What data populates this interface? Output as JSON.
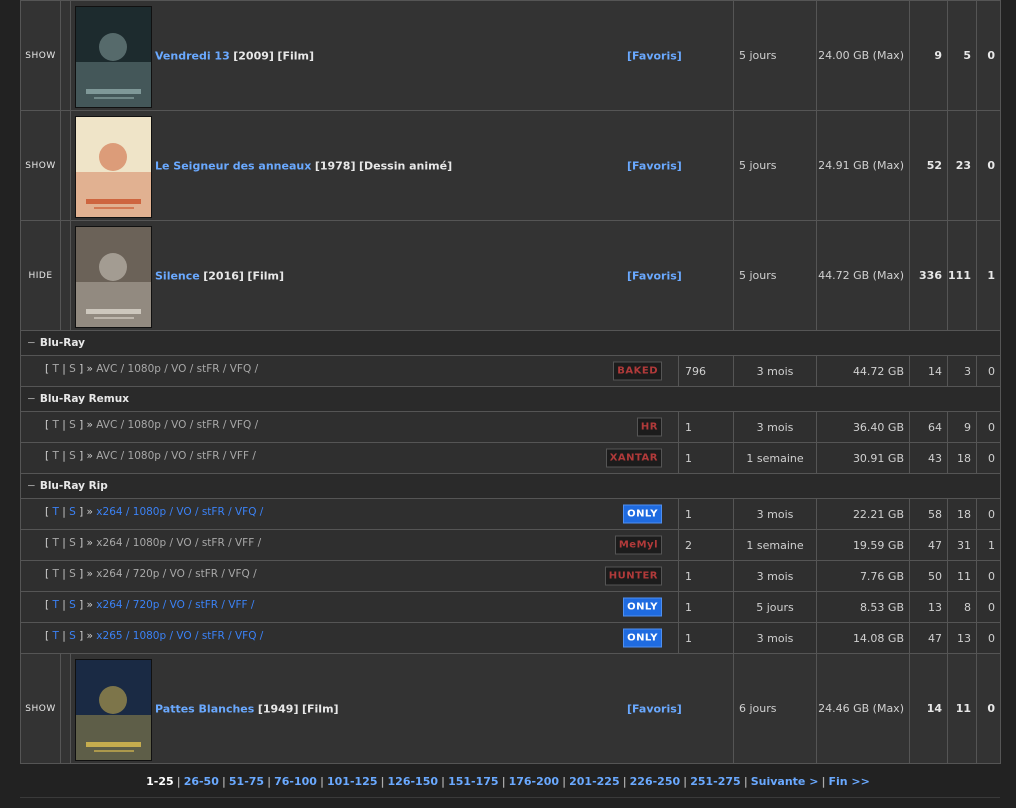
{
  "rows": [
    {
      "kind": "movie",
      "toggle": "SHOW",
      "title": "Vendredi 13",
      "year": "[2009]",
      "type": "[Film]",
      "fav": "[Favoris]",
      "age": "5 jours",
      "size": "24.00 GB (Max)",
      "n1": "9",
      "n2": "5",
      "n3": "0",
      "poster": {
        "bg": "#1d2b2e",
        "accent": "#8fa9a8"
      }
    },
    {
      "kind": "movie",
      "toggle": "SHOW",
      "title": "Le Seigneur des anneaux",
      "year": "[1978]",
      "type": "[Dessin animé]",
      "fav": "[Favoris]",
      "age": "5 jours",
      "size": "24.91 GB (Max)",
      "n1": "52",
      "n2": "23",
      "n3": "0",
      "poster": {
        "bg": "#efe4c8",
        "accent": "#c9532a"
      }
    },
    {
      "kind": "movie",
      "toggle": "HIDE",
      "title": "Silence",
      "year": "[2016]",
      "type": "[Film]",
      "fav": "[Favoris]",
      "age": "5 jours",
      "size": "44.72 GB (Max)",
      "n1": "336",
      "n2": "111",
      "n3": "1",
      "poster": {
        "bg": "#6b6258",
        "accent": "#dcd6cc"
      }
    },
    {
      "kind": "cat",
      "label": "Blu-Ray"
    },
    {
      "kind": "rel",
      "blue": false,
      "t": "T",
      "s": "S",
      "desc": "AVC / 1080p / VO / stFR / VFQ /",
      "badge": "BAKED",
      "only": false,
      "count": "796",
      "age": "3 mois",
      "size": "44.72 GB",
      "n1": "14",
      "n2": "3",
      "n3": "0"
    },
    {
      "kind": "cat",
      "label": "Blu-Ray Remux"
    },
    {
      "kind": "rel",
      "blue": false,
      "t": "T",
      "s": "S",
      "desc": "AVC / 1080p / VO / stFR / VFQ /",
      "badge": "HR",
      "only": false,
      "count": "1",
      "age": "3 mois",
      "size": "36.40 GB",
      "n1": "64",
      "n2": "9",
      "n3": "0"
    },
    {
      "kind": "rel",
      "blue": false,
      "t": "T",
      "s": "S",
      "desc": "AVC / 1080p / VO / stFR / VFF /",
      "badge": "XANTAR",
      "only": false,
      "count": "1",
      "age": "1 semaine",
      "size": "30.91 GB",
      "n1": "43",
      "n2": "18",
      "n3": "0"
    },
    {
      "kind": "cat",
      "label": "Blu-Ray Rip"
    },
    {
      "kind": "rel",
      "blue": true,
      "t": "T",
      "s": "S",
      "desc": "x264 / 1080p / VO / stFR / VFQ /",
      "badge": "ONLY",
      "only": true,
      "count": "1",
      "age": "3 mois",
      "size": "22.21 GB",
      "n1": "58",
      "n2": "18",
      "n3": "0"
    },
    {
      "kind": "rel",
      "blue": false,
      "t": "T",
      "s": "S",
      "desc": "x264 / 1080p / VO / stFR / VFF /",
      "badge": "MeMyl",
      "only": false,
      "count": "2",
      "age": "1 semaine",
      "size": "19.59 GB",
      "n1": "47",
      "n2": "31",
      "n3": "1"
    },
    {
      "kind": "rel",
      "blue": false,
      "t": "T",
      "s": "S",
      "desc": "x264 / 720p / VO / stFR / VFQ /",
      "badge": "HUNTER",
      "only": false,
      "count": "1",
      "age": "3 mois",
      "size": "7.76 GB",
      "n1": "50",
      "n2": "11",
      "n3": "0"
    },
    {
      "kind": "rel",
      "blue": true,
      "t": "T",
      "s": "S",
      "desc": "x264 / 720p / VO / stFR / VFF /",
      "badge": "ONLY",
      "only": true,
      "count": "1",
      "age": "5 jours",
      "size": "8.53 GB",
      "n1": "13",
      "n2": "8",
      "n3": "0"
    },
    {
      "kind": "rel",
      "blue": true,
      "t": "T",
      "s": "S",
      "desc": "x265 / 1080p / VO / stFR / VFQ /",
      "badge": "ONLY",
      "only": true,
      "count": "1",
      "age": "3 mois",
      "size": "14.08 GB",
      "n1": "47",
      "n2": "13",
      "n3": "0"
    },
    {
      "kind": "movie",
      "toggle": "SHOW",
      "title": "Pattes Blanches",
      "year": "[1949]",
      "type": "[Film]",
      "fav": "[Favoris]",
      "age": "6 jours",
      "size": "24.46 GB (Max)",
      "n1": "14",
      "n2": "11",
      "n3": "0",
      "poster": {
        "bg": "#1a2a44",
        "accent": "#e0c050"
      }
    }
  ],
  "pagination": {
    "current": "1-25",
    "pages": [
      "26-50",
      "51-75",
      "76-100",
      "101-125",
      "126-150",
      "151-175",
      "176-200",
      "201-225",
      "226-250",
      "251-275"
    ],
    "next": "Suivante >",
    "last": "Fin >>"
  }
}
